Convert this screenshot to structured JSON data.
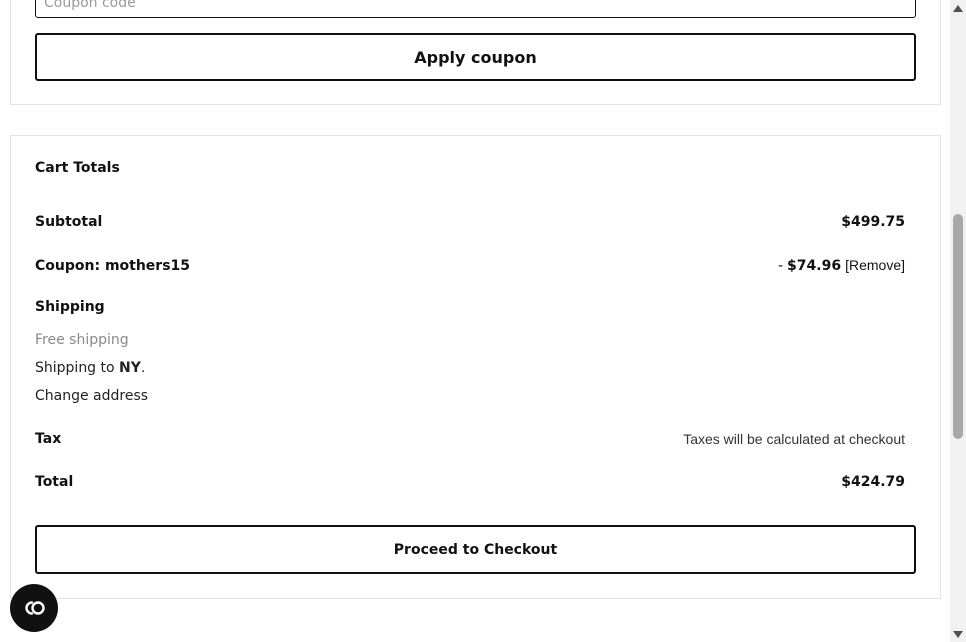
{
  "coupon": {
    "placeholder": "Coupon code",
    "apply_label": "Apply coupon"
  },
  "cart_totals": {
    "title": "Cart Totals",
    "subtotal": {
      "label": "Subtotal",
      "value": "$499.75"
    },
    "coupon": {
      "label": "Coupon: mothers15",
      "minus": "-",
      "amount": "$74.96",
      "remove_label": "[Remove]"
    },
    "shipping": {
      "label": "Shipping",
      "method": "Free shipping",
      "to_prefix": "Shipping to ",
      "to_state": "NY",
      "to_suffix": ".",
      "change_label": "Change address"
    },
    "tax": {
      "label": "Tax",
      "note": "Taxes will be calculated at checkout"
    },
    "total": {
      "label": "Total",
      "value": "$424.79"
    },
    "checkout_label": "Proceed to Checkout"
  },
  "chat": {
    "icon": "chat-logo-icon"
  },
  "colors": {
    "text": "#111111",
    "border": "#e3e3e3",
    "muted": "#8a8a8a",
    "fab": "#111111"
  }
}
